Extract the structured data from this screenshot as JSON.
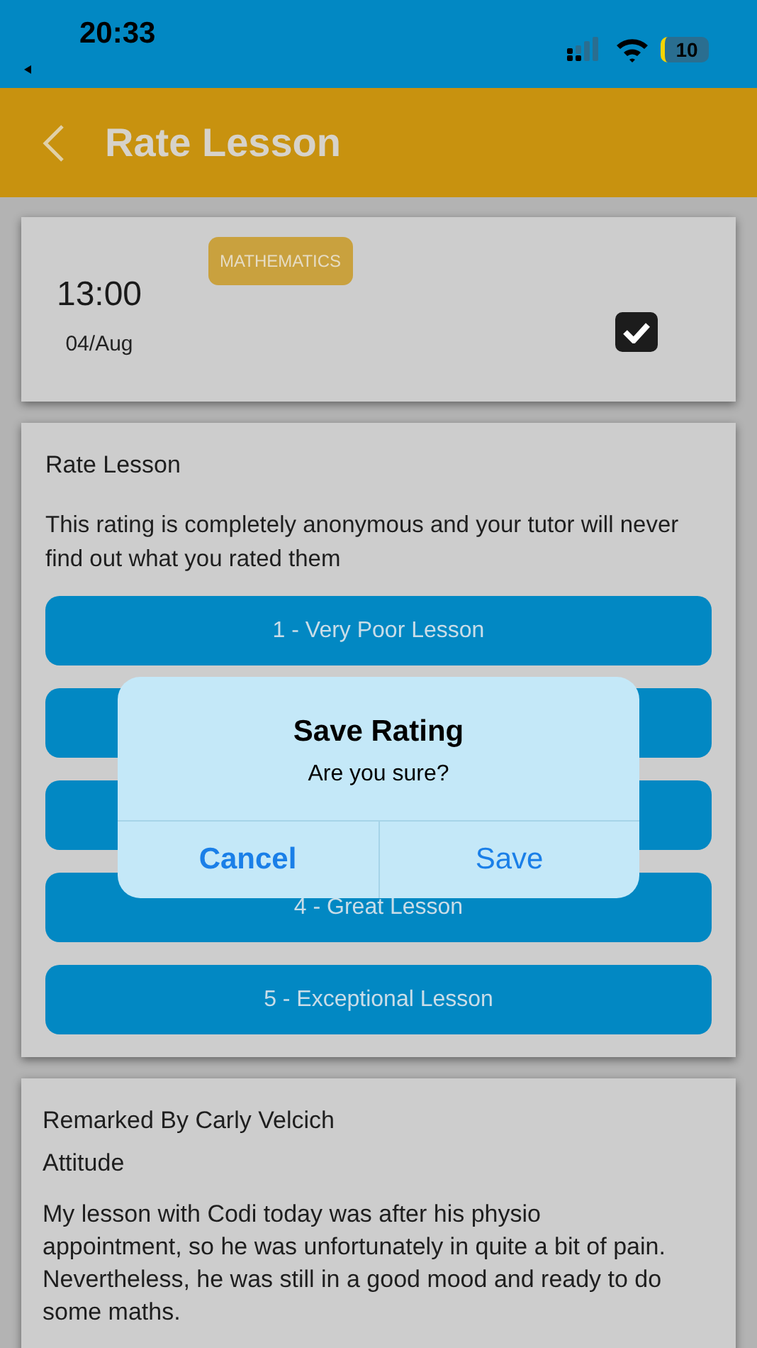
{
  "status_bar": {
    "time": "20:33",
    "battery": "10"
  },
  "header": {
    "title": "Rate Lesson"
  },
  "lesson": {
    "time": "13:00",
    "date": "04/Aug",
    "subject": "MATHEMATICS",
    "checked": true
  },
  "rating": {
    "title": "Rate Lesson",
    "note": "This rating is completely anonymous and your tutor will never find out what you rated them",
    "options": [
      {
        "kind": "button",
        "label": "1 - Very Poor Lesson"
      },
      {
        "kind": "button"
      },
      {
        "kind": "button"
      },
      {
        "kind": "button",
        "label": "4 - Great Lesson"
      },
      {
        "kind": "button",
        "label": "5 - Exceptional Lesson"
      }
    ]
  },
  "remark": {
    "author": "Remarked By Carly Velcich",
    "category": "Attitude",
    "text": "My lesson with Codi today was after his physio appointment, so he was unfortunately in quite a bit of pain. Nevertheless, he was still in a good mood and ready to do some maths."
  },
  "dialog": {
    "title": "Save Rating",
    "message": "Are you sure?",
    "buttons": [
      {
        "label": "Cancel",
        "kind": "cancel"
      },
      {
        "label": "Save",
        "kind": "default"
      }
    ]
  }
}
